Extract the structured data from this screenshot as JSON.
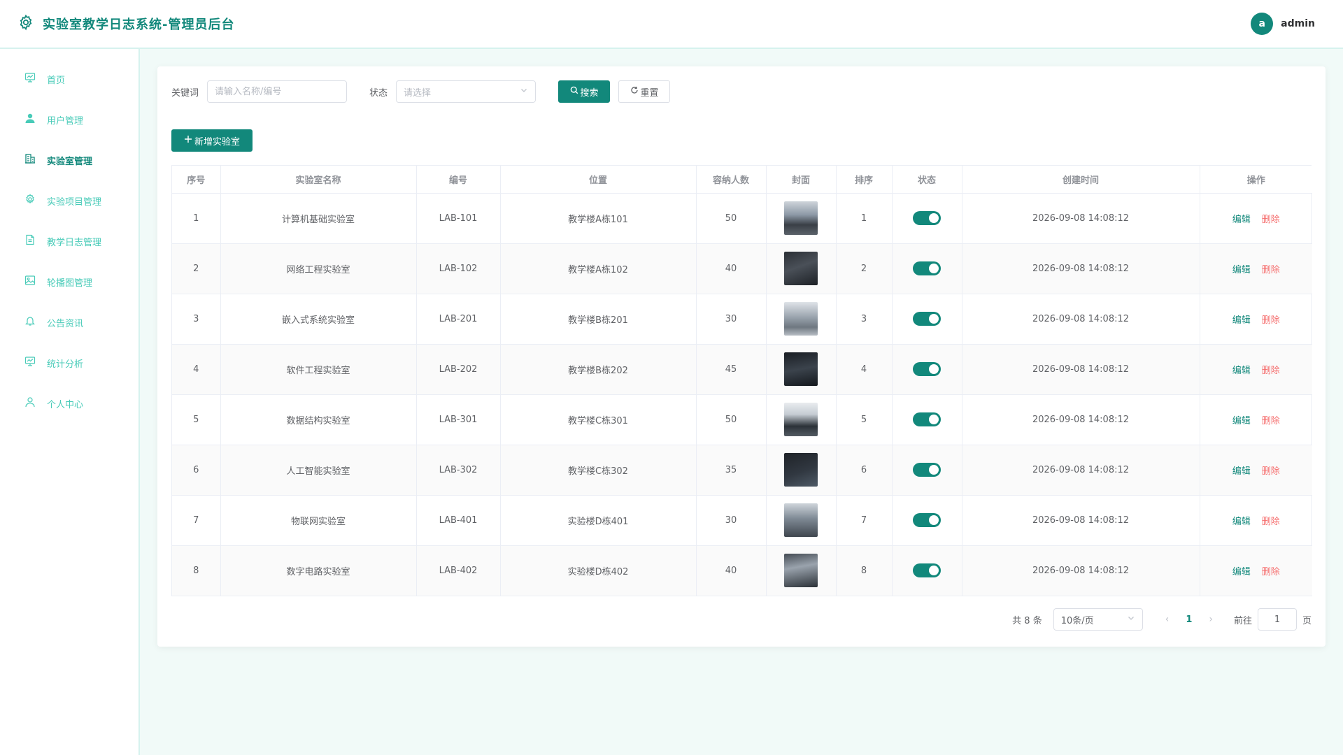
{
  "header": {
    "title": "实验室教学日志系统-管理员后台",
    "avatar_letter": "a",
    "username": "admin"
  },
  "sidebar": {
    "items": [
      {
        "label": "首页",
        "icon": "monitor-icon"
      },
      {
        "label": "用户管理",
        "icon": "user-icon"
      },
      {
        "label": "实验室管理",
        "icon": "building-icon"
      },
      {
        "label": "实验项目管理",
        "icon": "gear-icon"
      },
      {
        "label": "教学日志管理",
        "icon": "document-icon"
      },
      {
        "label": "轮播图管理",
        "icon": "image-icon"
      },
      {
        "label": "公告资讯",
        "icon": "bell-icon"
      },
      {
        "label": "统计分析",
        "icon": "monitor-icon"
      },
      {
        "label": "个人中心",
        "icon": "user-outline-icon"
      }
    ],
    "active_index": 2
  },
  "filters": {
    "keyword_label": "关键词",
    "keyword_placeholder": "请输入名称/编号",
    "keyword_value": "",
    "status_label": "状态",
    "status_placeholder": "请选择",
    "search_label": "搜索",
    "reset_label": "重置"
  },
  "add_button_label": "新增实验室",
  "table": {
    "columns": [
      "序号",
      "实验室名称",
      "编号",
      "位置",
      "容纳人数",
      "封面",
      "排序",
      "状态",
      "创建时间",
      "操作"
    ],
    "edit_label": "编辑",
    "delete_label": "删除",
    "rows": [
      {
        "index": "1",
        "name": "计算机基础实验室",
        "code": "LAB-101",
        "location": "教学楼A栋101",
        "capacity": "50",
        "sort": "1",
        "status_on": true,
        "created": "2026-09-08 14:08:12"
      },
      {
        "index": "2",
        "name": "网络工程实验室",
        "code": "LAB-102",
        "location": "教学楼A栋102",
        "capacity": "40",
        "sort": "2",
        "status_on": true,
        "created": "2026-09-08 14:08:12"
      },
      {
        "index": "3",
        "name": "嵌入式系统实验室",
        "code": "LAB-201",
        "location": "教学楼B栋201",
        "capacity": "30",
        "sort": "3",
        "status_on": true,
        "created": "2026-09-08 14:08:12"
      },
      {
        "index": "4",
        "name": "软件工程实验室",
        "code": "LAB-202",
        "location": "教学楼B栋202",
        "capacity": "45",
        "sort": "4",
        "status_on": true,
        "created": "2026-09-08 14:08:12"
      },
      {
        "index": "5",
        "name": "数据结构实验室",
        "code": "LAB-301",
        "location": "教学楼C栋301",
        "capacity": "50",
        "sort": "5",
        "status_on": true,
        "created": "2026-09-08 14:08:12"
      },
      {
        "index": "6",
        "name": "人工智能实验室",
        "code": "LAB-302",
        "location": "教学楼C栋302",
        "capacity": "35",
        "sort": "6",
        "status_on": true,
        "created": "2026-09-08 14:08:12"
      },
      {
        "index": "7",
        "name": "物联网实验室",
        "code": "LAB-401",
        "location": "实验楼D栋401",
        "capacity": "30",
        "sort": "7",
        "status_on": true,
        "created": "2026-09-08 14:08:12"
      },
      {
        "index": "8",
        "name": "数字电路实验室",
        "code": "LAB-402",
        "location": "实验楼D栋402",
        "capacity": "40",
        "sort": "8",
        "status_on": true,
        "created": "2026-09-08 14:08:12"
      }
    ]
  },
  "pagination": {
    "total_text": "共 8 条",
    "page_size": "10条/页",
    "current_page": "1",
    "goto_label": "前往",
    "goto_value": "1",
    "page_unit": "页"
  },
  "colors": {
    "primary": "#12887b",
    "nav_text": "#48cbb8",
    "danger": "#f56c6c"
  }
}
